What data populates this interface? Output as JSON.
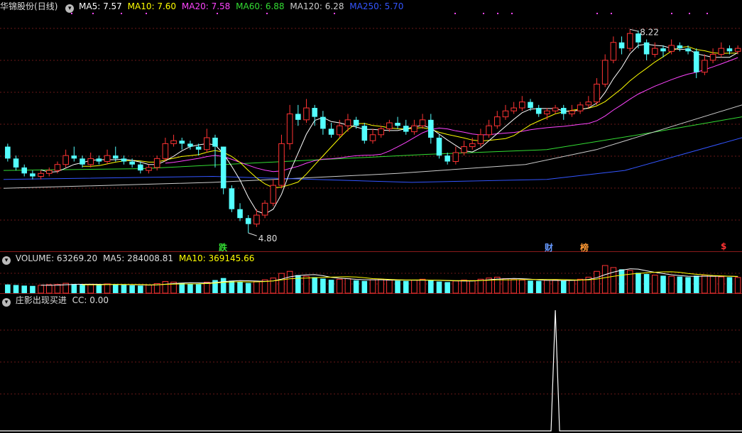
{
  "stock": {
    "name": "华锦股份",
    "period": "(日线)"
  },
  "main_indicators": [
    {
      "label": "MA5: 7.57",
      "color": "#ffffff"
    },
    {
      "label": "MA10: 7.60",
      "color": "#ffff00"
    },
    {
      "label": "MA20: 7.58",
      "color": "#ff44ff"
    },
    {
      "label": "MA60: 6.88",
      "color": "#33dd33"
    },
    {
      "label": "MA120: 6.28",
      "color": "#cccccc"
    },
    {
      "label": "MA250: 5.70",
      "color": "#3355ff"
    }
  ],
  "volume_panel": {
    "label": "VOLUME: 63269.20",
    "ma5": "MA5: 284008.81",
    "ma10": "MA10: 369145.66"
  },
  "signal_panel": {
    "label": "庄影出现买进",
    "cc": "CC: 0.00"
  },
  "markers": {
    "high_label": "8.22",
    "low_label": "4.80",
    "fall": "跌",
    "finance": "财",
    "rank": "榜",
    "dollar": "$"
  },
  "chart_data": {
    "type": "candlestick",
    "high_annotation": 8.22,
    "low_annotation": 4.8,
    "candles": [
      [
        6.25,
        6.05,
        6.3,
        6.0
      ],
      [
        6.05,
        5.9,
        6.1,
        5.85
      ],
      [
        5.9,
        5.8,
        5.95,
        5.75
      ],
      [
        5.8,
        5.75,
        5.85,
        5.7
      ],
      [
        5.75,
        5.8,
        5.85,
        5.7
      ],
      [
        5.8,
        5.85,
        5.9,
        5.75
      ],
      [
        5.85,
        5.95,
        6.0,
        5.8
      ],
      [
        5.95,
        6.1,
        6.2,
        5.9
      ],
      [
        6.1,
        6.05,
        6.25,
        6.0
      ],
      [
        6.05,
        5.95,
        6.1,
        5.9
      ],
      [
        5.95,
        6.05,
        6.15,
        5.9
      ],
      [
        6.05,
        6.0,
        6.1,
        5.95
      ],
      [
        6.0,
        6.1,
        6.2,
        5.95
      ],
      [
        6.1,
        6.05,
        6.25,
        6.0
      ],
      [
        6.05,
        6.0,
        6.1,
        5.95
      ],
      [
        6.0,
        5.95,
        6.05,
        5.9
      ],
      [
        5.95,
        5.85,
        6.0,
        5.8
      ],
      [
        5.85,
        5.9,
        5.95,
        5.8
      ],
      [
        5.9,
        6.05,
        6.1,
        5.85
      ],
      [
        6.05,
        6.3,
        6.4,
        6.0
      ],
      [
        6.3,
        6.35,
        6.45,
        6.25
      ],
      [
        6.35,
        6.3,
        6.4,
        6.2
      ],
      [
        6.3,
        6.25,
        6.35,
        6.2
      ],
      [
        6.25,
        6.2,
        6.3,
        6.1
      ],
      [
        6.2,
        6.4,
        6.55,
        6.15
      ],
      [
        6.4,
        6.25,
        6.45,
        5.9
      ],
      [
        6.25,
        5.55,
        6.25,
        5.45
      ],
      [
        5.55,
        5.2,
        5.6,
        5.15
      ],
      [
        5.2,
        5.05,
        5.3,
        5.0
      ],
      [
        5.05,
        4.95,
        5.1,
        4.8
      ],
      [
        4.95,
        5.1,
        5.2,
        4.9
      ],
      [
        5.1,
        5.3,
        5.35,
        5.05
      ],
      [
        5.3,
        5.6,
        5.7,
        5.25
      ],
      [
        5.6,
        6.3,
        6.45,
        5.55
      ],
      [
        6.3,
        6.8,
        6.95,
        6.2
      ],
      [
        6.8,
        6.7,
        6.95,
        6.6
      ],
      [
        6.7,
        6.9,
        7.05,
        6.65
      ],
      [
        6.9,
        6.75,
        6.95,
        6.6
      ],
      [
        6.75,
        6.55,
        6.85,
        6.45
      ],
      [
        6.55,
        6.45,
        6.65,
        6.4
      ],
      [
        6.45,
        6.6,
        6.7,
        6.4
      ],
      [
        6.6,
        6.7,
        6.8,
        6.5
      ],
      [
        6.7,
        6.6,
        6.75,
        6.55
      ],
      [
        6.6,
        6.35,
        6.65,
        6.3
      ],
      [
        6.35,
        6.45,
        6.55,
        6.3
      ],
      [
        6.45,
        6.55,
        6.6,
        6.4
      ],
      [
        6.55,
        6.65,
        6.7,
        6.5
      ],
      [
        6.65,
        6.6,
        6.75,
        6.55
      ],
      [
        6.6,
        6.5,
        6.7,
        6.45
      ],
      [
        6.5,
        6.6,
        6.7,
        6.45
      ],
      [
        6.6,
        6.7,
        6.8,
        6.55
      ],
      [
        6.7,
        6.4,
        6.8,
        6.3
      ],
      [
        6.4,
        6.1,
        6.45,
        6.05
      ],
      [
        6.1,
        6.0,
        6.15,
        5.95
      ],
      [
        6.0,
        6.15,
        6.25,
        5.95
      ],
      [
        6.15,
        6.25,
        6.35,
        6.1
      ],
      [
        6.25,
        6.3,
        6.4,
        6.2
      ],
      [
        6.3,
        6.45,
        6.55,
        6.25
      ],
      [
        6.45,
        6.6,
        6.7,
        6.4
      ],
      [
        6.6,
        6.75,
        6.85,
        6.55
      ],
      [
        6.75,
        6.85,
        6.95,
        6.7
      ],
      [
        6.85,
        6.9,
        7.0,
        6.8
      ],
      [
        6.9,
        7.0,
        7.1,
        6.85
      ],
      [
        7.0,
        6.9,
        7.05,
        6.85
      ],
      [
        6.9,
        6.8,
        6.95,
        6.75
      ],
      [
        6.8,
        6.85,
        6.9,
        6.7
      ],
      [
        6.85,
        6.9,
        6.95,
        6.8
      ],
      [
        6.9,
        6.8,
        6.95,
        6.7
      ],
      [
        6.8,
        6.85,
        6.95,
        6.75
      ],
      [
        6.85,
        6.95,
        7.0,
        6.8
      ],
      [
        6.95,
        7.0,
        7.1,
        6.9
      ],
      [
        7.0,
        7.3,
        7.4,
        6.95
      ],
      [
        7.3,
        7.7,
        7.8,
        7.25
      ],
      [
        7.7,
        8.0,
        8.1,
        7.65
      ],
      [
        8.0,
        7.9,
        8.1,
        7.8
      ],
      [
        7.9,
        8.15,
        8.22,
        7.85
      ],
      [
        8.15,
        8.0,
        8.2,
        7.9
      ],
      [
        8.0,
        7.8,
        8.05,
        7.7
      ],
      [
        7.8,
        7.9,
        8.0,
        7.75
      ],
      [
        7.9,
        7.85,
        7.95,
        7.75
      ],
      [
        7.85,
        7.95,
        8.05,
        7.8
      ],
      [
        7.95,
        7.9,
        8.0,
        7.85
      ],
      [
        7.9,
        7.85,
        7.95,
        7.8
      ],
      [
        7.85,
        7.5,
        7.9,
        7.4
      ],
      [
        7.5,
        7.7,
        7.8,
        7.45
      ],
      [
        7.7,
        7.8,
        7.9,
        7.65
      ],
      [
        7.8,
        7.9,
        8.0,
        7.75
      ],
      [
        7.9,
        7.85,
        7.95,
        7.8
      ],
      [
        7.85,
        7.9,
        7.95,
        7.8
      ]
    ],
    "volumes": [
      30,
      28,
      26,
      25,
      27,
      29,
      30,
      34,
      31,
      29,
      30,
      28,
      32,
      30,
      28,
      27,
      26,
      28,
      33,
      40,
      38,
      35,
      33,
      31,
      38,
      45,
      52,
      43,
      38,
      35,
      40,
      46,
      52,
      68,
      75,
      62,
      58,
      55,
      50,
      46,
      48,
      50,
      44,
      42,
      46,
      48,
      45,
      43,
      42,
      45,
      48,
      44,
      40,
      38,
      42,
      45,
      43,
      48,
      52,
      55,
      50,
      47,
      45,
      43,
      42,
      44,
      45,
      43,
      45,
      48,
      55,
      75,
      95,
      88,
      82,
      78,
      70,
      66,
      62,
      60,
      58,
      57,
      55,
      60,
      62,
      58,
      56,
      55,
      54
    ],
    "volume_ma5_label": "284008.81",
    "volume_ma10_label": "369145.66",
    "signal": {
      "name": "庄影出现买进",
      "spike_index": 66,
      "cc": 0.0
    }
  }
}
